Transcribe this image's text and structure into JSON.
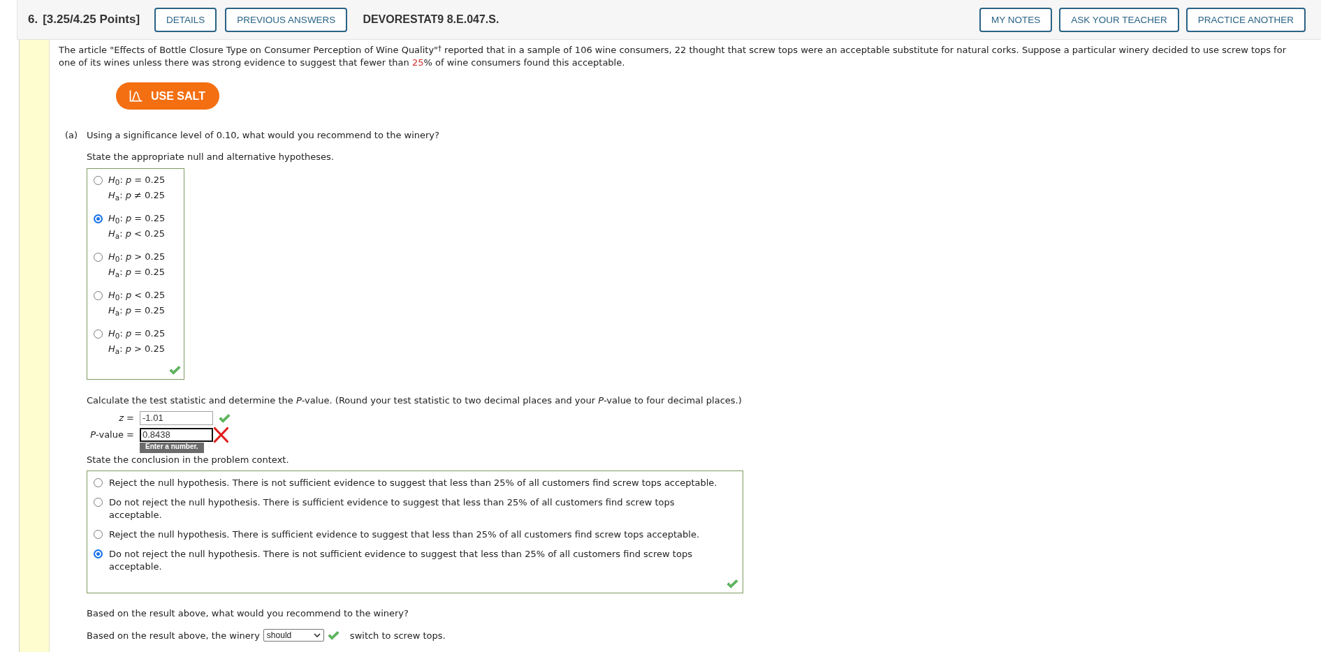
{
  "header": {
    "number": "6.",
    "points": "[3.25/4.25 Points]",
    "left_buttons": [
      {
        "label": "DETAILS"
      },
      {
        "label": "PREVIOUS ANSWERS"
      }
    ],
    "code": "DEVORESTAT9 8.E.047.S.",
    "right_buttons": [
      {
        "label": "MY NOTES"
      },
      {
        "label": "ASK YOUR TEACHER"
      },
      {
        "label": "PRACTICE ANOTHER"
      }
    ]
  },
  "intro": {
    "parts": [
      {
        "text": "The article \"Effects of Bottle Closure Type on Consumer Perception of Wine Quality\"$^{†}$ reported that in a sample of 106 wine consumers, 22 thought that screw tops were an acceptable substitute for natural corks. Suppose a particular winery decided to use screw tops for one of its wines unless there was strong evidence to suggest that fewer than ",
        "highlight": false
      },
      {
        "text": "25",
        "highlight": true
      },
      {
        "text": "% of wine consumers found this acceptable.",
        "highlight": false
      }
    ]
  },
  "salt_button": {
    "label": "USE SALT"
  },
  "part_a": {
    "label": "(a)",
    "question": "Using a significance level of 0.10, what would you recommend to the winery?",
    "hypotheses": {
      "prompt": "State the appropriate null and alternative hypotheses.",
      "options": [
        {
          "h0": "*H*$_{0}$: *p* = 0.25",
          "ha": "*H*$_{a}$: *p* ≠ 0.25",
          "selected": false
        },
        {
          "h0": "*H*$_{0}$: *p* = 0.25",
          "ha": "*H*$_{a}$: *p* < 0.25",
          "selected": true
        },
        {
          "h0": "*H*$_{0}$: *p* > 0.25",
          "ha": "*H*$_{a}$: *p* = 0.25",
          "selected": false
        },
        {
          "h0": "*H*$_{0}$: *p* < 0.25",
          "ha": "*H*$_{a}$: *p* = 0.25",
          "selected": false
        },
        {
          "h0": "*H*$_{0}$: *p* = 0.25",
          "ha": "*H*$_{a}$: *p* > 0.25",
          "selected": false
        }
      ],
      "correct": true
    },
    "test_statistic": {
      "prompt": "Calculate the test statistic and determine the *P*-value. (Round your test statistic to two decimal places and your *P*-value to four decimal places.)",
      "fields": [
        {
          "label": "*z* =",
          "value": "-1.01",
          "correct": true,
          "focused": false
        },
        {
          "label": "*P*-value =",
          "value": "0.8438",
          "correct": false,
          "focused": true,
          "tooltip": "Enter a number."
        }
      ]
    },
    "conclusion": {
      "prompt": "State the conclusion in the problem context.",
      "options": [
        {
          "text": "Reject the null hypothesis. There is not sufficient evidence to suggest that less than 25% of all customers find screw tops acceptable.",
          "selected": false
        },
        {
          "text": "Do not reject the null hypothesis. There is sufficient evidence to suggest that less than 25% of all customers find screw tops acceptable.",
          "selected": false
        },
        {
          "text": "Reject the null hypothesis. There is sufficient evidence to suggest that less than 25% of all customers find screw tops acceptable.",
          "selected": false
        },
        {
          "text": "Do not reject the null hypothesis. There is not sufficient evidence to suggest that less than 25% of all customers find screw tops acceptable.",
          "selected": true
        }
      ],
      "correct": true
    },
    "recommendation": {
      "question": "Based on the result above, what would you recommend to the winery?",
      "text_before": "Based on the result above, the winery",
      "dropdown": {
        "value": "should",
        "correct": true
      },
      "text_after": "switch to screw tops."
    }
  }
}
